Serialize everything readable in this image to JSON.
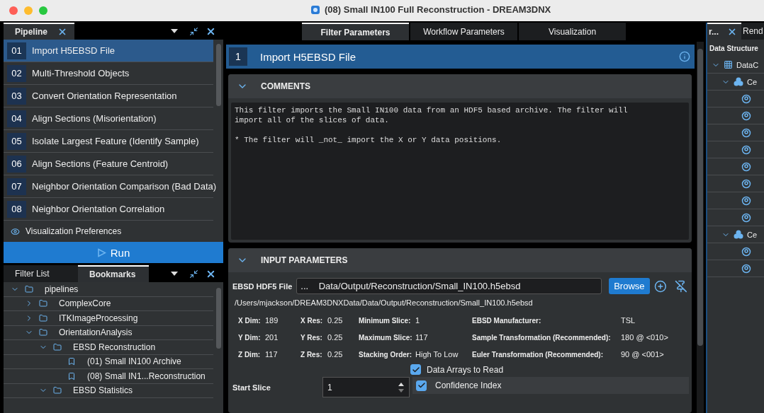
{
  "window": {
    "title": "(08) Small IN100 Full Reconstruction - DREAM3DNX"
  },
  "pipeline_panel": {
    "tab": "Pipeline",
    "items": [
      {
        "number": "01",
        "label": "Import H5EBSD File",
        "selected": true
      },
      {
        "number": "02",
        "label": "Multi-Threshold Objects",
        "selected": false
      },
      {
        "number": "03",
        "label": "Convert Orientation Representation",
        "selected": false
      },
      {
        "number": "04",
        "label": "Align Sections (Misorientation)",
        "selected": false
      },
      {
        "number": "05",
        "label": "Isolate Largest Feature (Identify Sample)",
        "selected": false
      },
      {
        "number": "06",
        "label": "Align Sections (Feature Centroid)",
        "selected": false
      },
      {
        "number": "07",
        "label": "Neighbor Orientation Comparison (Bad Data)",
        "selected": false
      },
      {
        "number": "08",
        "label": "Neighbor Orientation Correlation",
        "selected": false
      }
    ],
    "visualization_preferences": "Visualization Preferences",
    "run_button": "Run"
  },
  "bottom_panel": {
    "tabs": [
      {
        "label": "Filter List",
        "selected": false
      },
      {
        "label": "Bookmarks",
        "selected": true
      }
    ],
    "tree": [
      {
        "kind": "folder",
        "label": "pipelines",
        "expanded": true,
        "children": [
          {
            "kind": "folder",
            "label": "ComplexCore",
            "expanded": false
          },
          {
            "kind": "folder",
            "label": "ITKImageProcessing",
            "expanded": false
          },
          {
            "kind": "folder",
            "label": "OrientationAnalysis",
            "expanded": true,
            "children": [
              {
                "kind": "folder",
                "label": "EBSD Reconstruction",
                "expanded": true,
                "children": [
                  {
                    "kind": "bookmark",
                    "label": "(01) Small IN100 Archive"
                  },
                  {
                    "kind": "bookmark",
                    "label": "(08) Small IN1...Reconstruction"
                  }
                ]
              },
              {
                "kind": "folder",
                "label": "EBSD Statistics",
                "expanded": true
              }
            ]
          }
        ]
      }
    ]
  },
  "center": {
    "tabs": [
      {
        "label": "Filter Parameters",
        "selected": true
      },
      {
        "label": "Workflow Parameters",
        "selected": false
      },
      {
        "label": "Visualization",
        "selected": false
      }
    ],
    "filter_header": {
      "number": "1",
      "title": "Import H5EBSD File"
    },
    "comments": {
      "title": "COMMENTS",
      "expanded": true,
      "text": "This filter imports the Small IN100 data from an HDF5 based archive. The filter will\nimport all of the slices of data.\n\n* The filter will _not_ import the X or Y data positions."
    },
    "input_parameters": {
      "title": "INPUT PARAMETERS",
      "expanded": true,
      "file_label": "EBSD HDF5 File",
      "file_value": "...    Data/Output/Reconstruction/Small_IN100.h5ebsd",
      "browse_button": "Browse",
      "full_path": "/Users/mjackson/DREAM3DNXData/Data/Output/Reconstruction/Small_IN100.h5ebsd",
      "info_rows": [
        [
          {
            "label": "X Dim:",
            "value": "189"
          },
          {
            "label": "X Res:",
            "value": "0.25"
          },
          {
            "label": "Minimum Slice:",
            "value": "1"
          },
          {
            "label": "EBSD Manufacturer:",
            "value": "TSL"
          }
        ],
        [
          {
            "label": "Y Dim:",
            "value": "201"
          },
          {
            "label": "Y Res:",
            "value": "0.25"
          },
          {
            "label": "Maximum Slice:",
            "value": "117"
          },
          {
            "label": "Sample Transformation (Recommended):",
            "value": "180 @ <010>"
          }
        ],
        [
          {
            "label": "Z Dim:",
            "value": "117"
          },
          {
            "label": "Z Res:",
            "value": "0.25"
          },
          {
            "label": "Stacking Order:",
            "value": "High To Low"
          },
          {
            "label": "Euler Transformation (Recommended):",
            "value": "90 @ <001>"
          }
        ]
      ],
      "data_arrays": {
        "label": "Data Arrays to Read",
        "checked": true,
        "items": [
          {
            "label": "Confidence Index",
            "checked": true
          }
        ]
      },
      "start_slice": {
        "label": "Start Slice",
        "value": "1"
      }
    }
  },
  "right_panel": {
    "tabs": [
      {
        "label": "r...",
        "selected": true
      },
      {
        "label": "Rend",
        "selected": false
      }
    ],
    "header": "Data Structure",
    "tree": [
      {
        "kind": "geometry",
        "label": "DataC",
        "expanded": true,
        "children": [
          {
            "kind": "group",
            "label": "Ce",
            "expanded": true,
            "children": [
              {
                "kind": "array"
              },
              {
                "kind": "array"
              },
              {
                "kind": "array"
              },
              {
                "kind": "array"
              },
              {
                "kind": "array"
              },
              {
                "kind": "array"
              },
              {
                "kind": "array"
              },
              {
                "kind": "array"
              }
            ]
          },
          {
            "kind": "group",
            "label": "Ce",
            "expanded": true,
            "children": [
              {
                "kind": "array"
              },
              {
                "kind": "array"
              }
            ]
          }
        ]
      }
    ]
  }
}
